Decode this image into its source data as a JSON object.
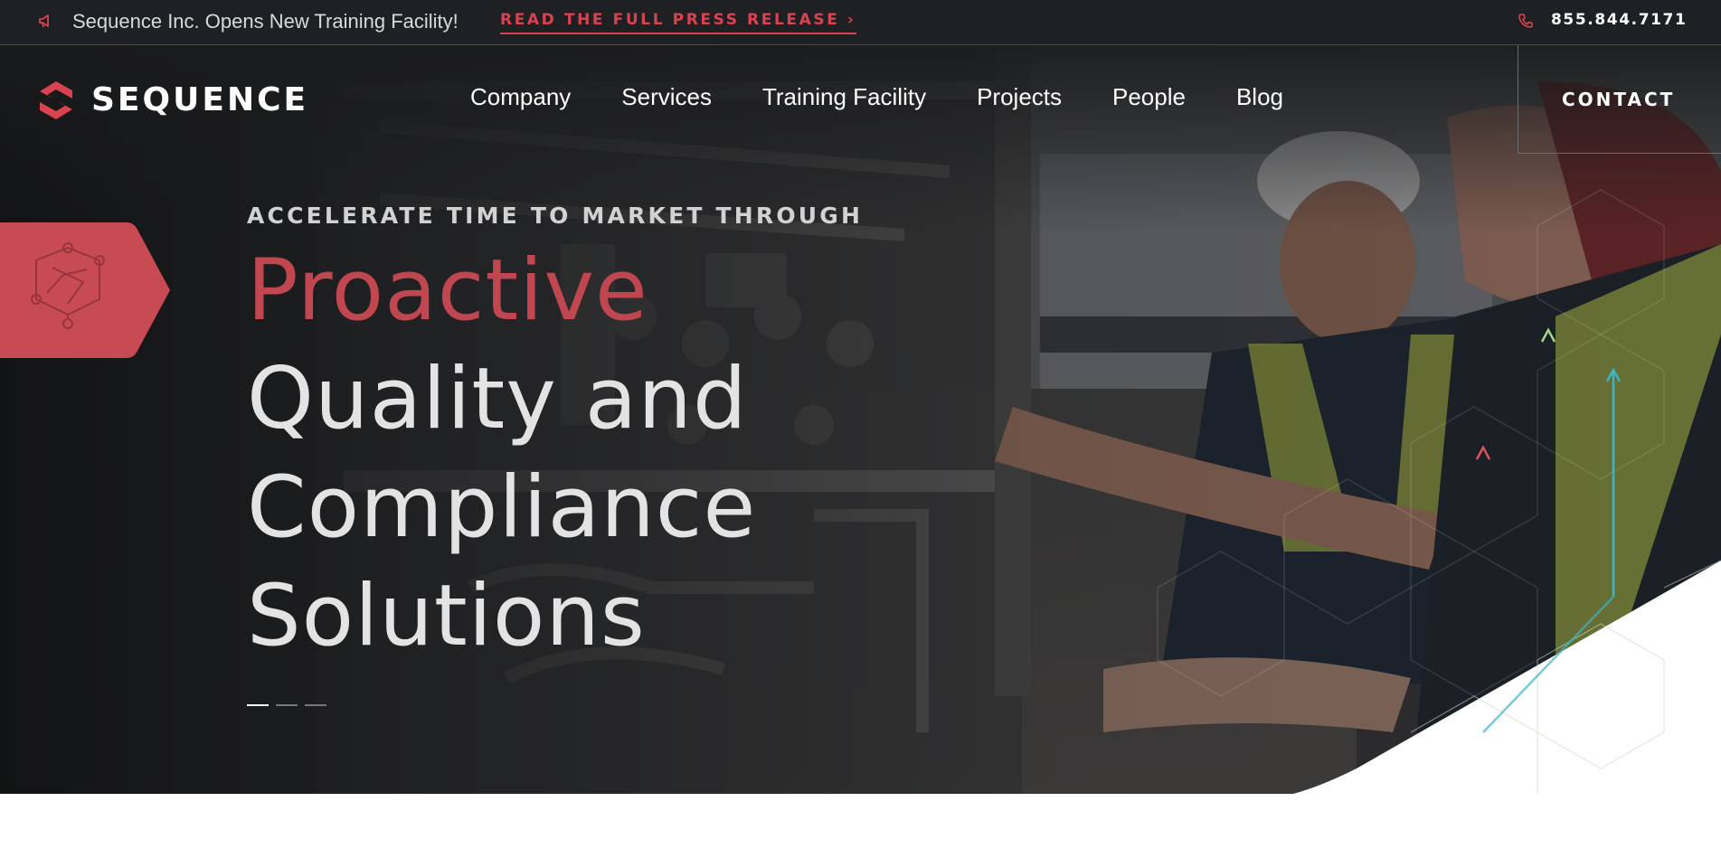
{
  "announcement": {
    "text": "Sequence Inc. Opens New Training Facility!",
    "link_label": "READ THE FULL PRESS RELEASE  ›",
    "phone": "855.844.7171",
    "megaphone_icon": "megaphone-icon",
    "phone_icon": "phone-icon"
  },
  "nav": {
    "brand": "SEQUENCE",
    "logo_icon": "sequence-s-logo",
    "items": [
      {
        "label": "Company"
      },
      {
        "label": "Services"
      },
      {
        "label": "Training Facility"
      },
      {
        "label": "Projects"
      },
      {
        "label": "People"
      },
      {
        "label": "Blog"
      }
    ],
    "contact_label": "CONTACT"
  },
  "hero": {
    "eyebrow": "ACCELERATE TIME TO MARKET THROUGH",
    "headline_accent": "Proactive",
    "headline_lines": [
      "Quality and",
      "Compliance",
      "Solutions"
    ],
    "badge_icon": "network-hexagon-icon",
    "slides": {
      "count": 3,
      "active": 1
    }
  },
  "colors": {
    "brand_red": "#d9434f",
    "accent_red": "#c0464f",
    "topbar_bg": "#1f2023",
    "arrow_red": "#e0525c",
    "arrow_green": "#a6d88a",
    "arrow_teal": "#3fb3c4"
  }
}
